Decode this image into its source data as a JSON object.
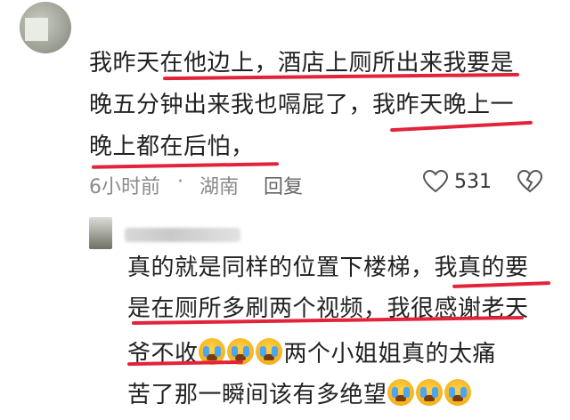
{
  "comment1": {
    "lines": [
      "我昨天在他边上，酒店上厕所出来我要是",
      "晚五分钟出来我也嗝屁了，我昨天晚上一",
      "晚上都在后怕，"
    ],
    "time": "6小时前",
    "separator": "·",
    "location": "湖南",
    "reply_label": "回复",
    "like_count": "531"
  },
  "comment2": {
    "lines": [
      "真的就是同样的位置下楼梯，我真的要",
      "是在厕所多刷两个视频，我很感谢老天",
      "爷不收",
      "两个小姐姐真的太痛",
      "苦了那一瞬间该有多绝望"
    ]
  },
  "colors": {
    "underline": "#e2233a",
    "meta_text": "#8a8a8a"
  },
  "icons": {
    "like": "heart-outline-icon",
    "dislike": "broken-heart-icon",
    "emoji": "loudly-crying-face-emoji"
  }
}
